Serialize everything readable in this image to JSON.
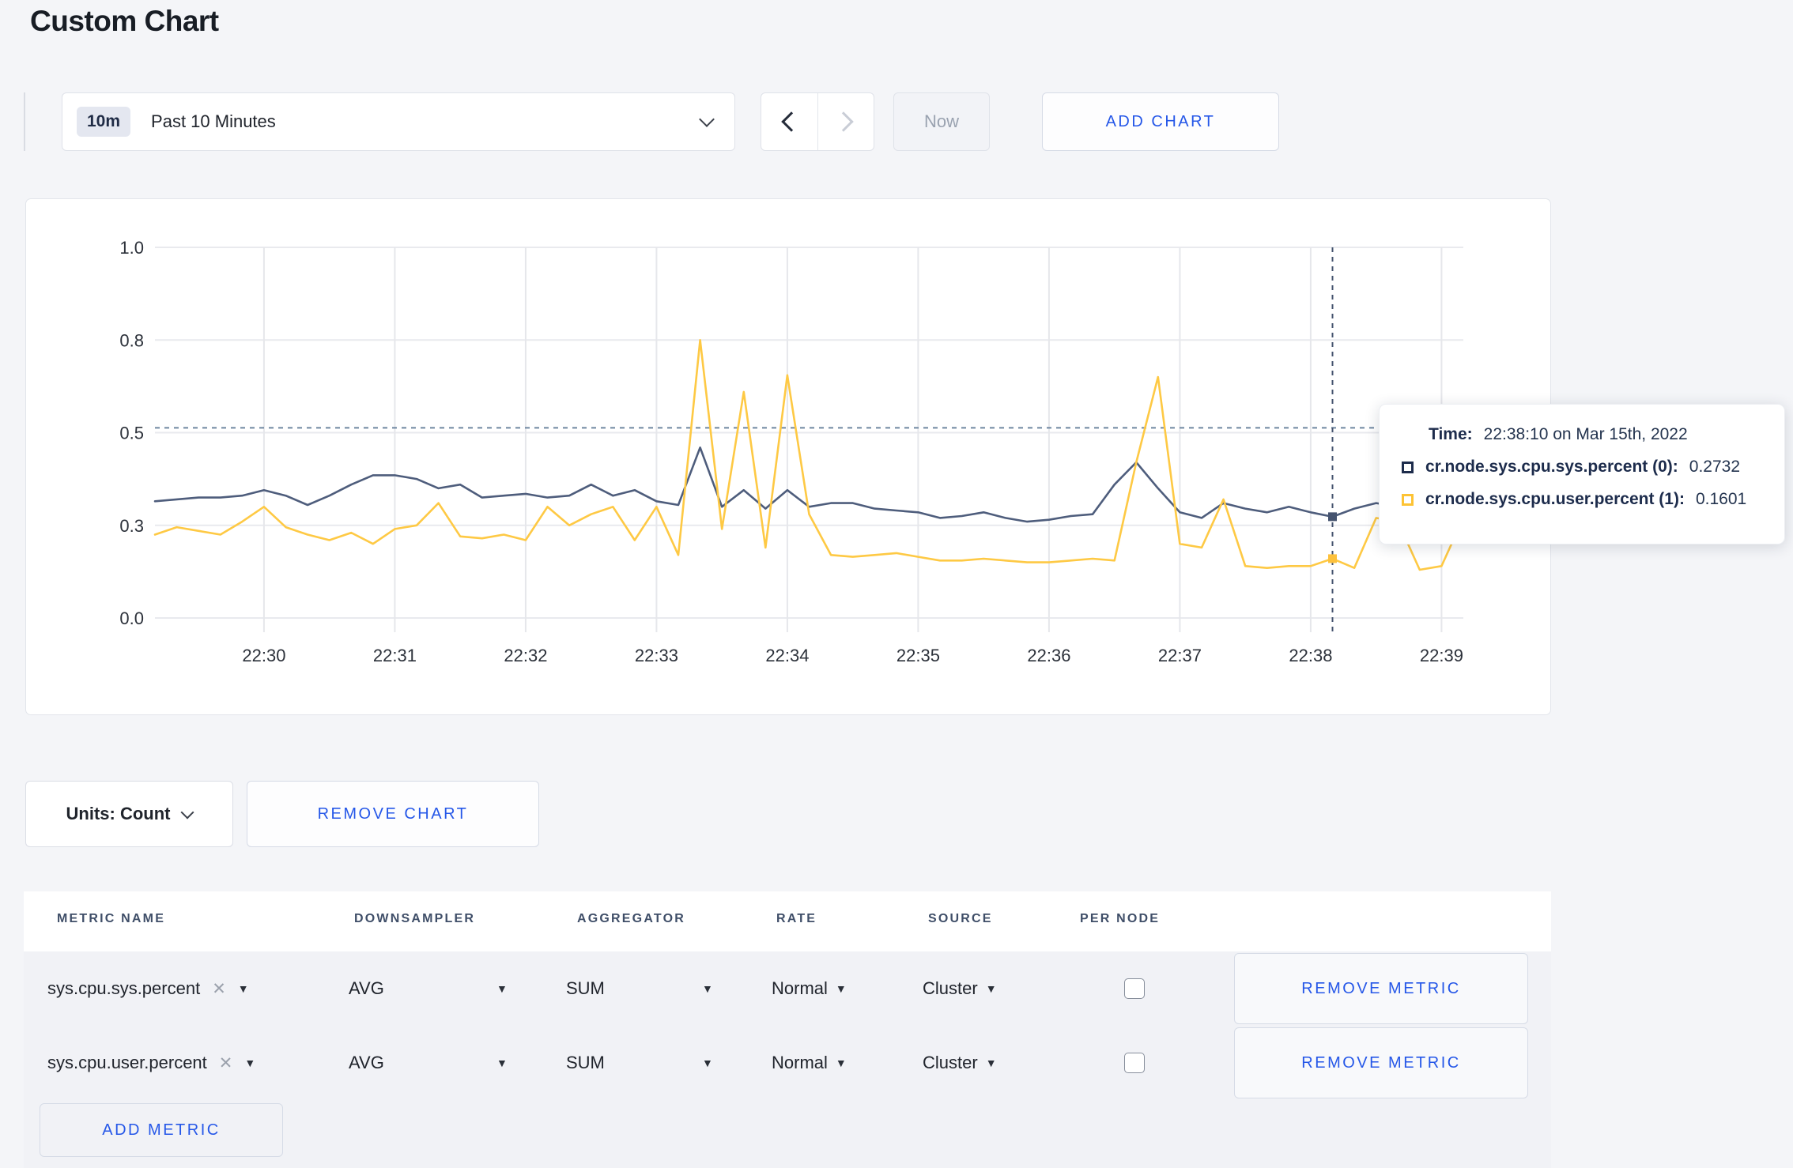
{
  "page": {
    "title": "Custom Chart"
  },
  "toolbar": {
    "range_badge": "10m",
    "range_label": "Past 10 Minutes",
    "now_label": "Now",
    "add_chart_label": "ADD CHART"
  },
  "chart": {
    "units_label": "Units: Count",
    "remove_chart_label": "REMOVE CHART"
  },
  "chart_data": {
    "type": "line",
    "title": "",
    "start_time": "22:29:10",
    "sample_interval_seconds": 10,
    "ylim": [
      0,
      1
    ],
    "grid": true,
    "legend_position": "tooltip",
    "y_ticks": [
      {
        "value": 0,
        "label": "0.0"
      },
      {
        "value": 0.25,
        "label": "0.3"
      },
      {
        "value": 0.5,
        "label": "0.5"
      },
      {
        "value": 0.75,
        "label": "0.8"
      },
      {
        "value": 1,
        "label": "1.0"
      }
    ],
    "x_ticks": [
      {
        "index": 5,
        "label": "22:30"
      },
      {
        "index": 11,
        "label": "22:31"
      },
      {
        "index": 17,
        "label": "22:32"
      },
      {
        "index": 23,
        "label": "22:33"
      },
      {
        "index": 29,
        "label": "22:34"
      },
      {
        "index": 35,
        "label": "22:35"
      },
      {
        "index": 41,
        "label": "22:36"
      },
      {
        "index": 47,
        "label": "22:37"
      },
      {
        "index": 53,
        "label": "22:38"
      },
      {
        "index": 59,
        "label": "22:39"
      }
    ],
    "series": [
      {
        "name": "cr.node.sys.cpu.sys.percent",
        "color": "#4e5d7c",
        "values": [
          0.315,
          0.32,
          0.325,
          0.325,
          0.33,
          0.345,
          0.33,
          0.305,
          0.33,
          0.36,
          0.385,
          0.385,
          0.375,
          0.35,
          0.36,
          0.325,
          0.33,
          0.335,
          0.325,
          0.33,
          0.36,
          0.33,
          0.345,
          0.315,
          0.305,
          0.46,
          0.3,
          0.345,
          0.295,
          0.345,
          0.3,
          0.31,
          0.31,
          0.295,
          0.29,
          0.285,
          0.27,
          0.275,
          0.285,
          0.27,
          0.26,
          0.265,
          0.275,
          0.28,
          0.36,
          0.42,
          0.35,
          0.285,
          0.27,
          0.31,
          0.295,
          0.285,
          0.3,
          0.285,
          0.2732,
          0.295,
          0.31,
          0.3,
          0.295,
          0.3,
          0.31
        ]
      },
      {
        "name": "cr.node.sys.cpu.user.percent",
        "color": "#fec944",
        "values": [
          0.225,
          0.245,
          0.235,
          0.225,
          0.26,
          0.3,
          0.245,
          0.225,
          0.21,
          0.23,
          0.2,
          0.24,
          0.25,
          0.31,
          0.22,
          0.215,
          0.225,
          0.21,
          0.3,
          0.25,
          0.28,
          0.3,
          0.21,
          0.3,
          0.17,
          0.75,
          0.24,
          0.61,
          0.19,
          0.655,
          0.28,
          0.17,
          0.165,
          0.17,
          0.175,
          0.165,
          0.155,
          0.155,
          0.16,
          0.155,
          0.15,
          0.15,
          0.155,
          0.16,
          0.155,
          0.42,
          0.65,
          0.2,
          0.19,
          0.32,
          0.14,
          0.135,
          0.14,
          0.14,
          0.1601,
          0.135,
          0.27,
          0.26,
          0.13,
          0.14,
          0.27
        ]
      }
    ],
    "crosshair": {
      "index": 54,
      "time": "22:38:10",
      "h_line_value": 0.513,
      "point_values": [
        0.2732,
        0.1601
      ]
    }
  },
  "tooltip": {
    "time_label": "Time:",
    "time_value": "22:38:10 on Mar 15th, 2022",
    "entries": [
      {
        "swatch_color": "#1d2c4c",
        "label": "cr.node.sys.cpu.sys.percent (0):",
        "value": "0.2732"
      },
      {
        "swatch_color": "#fdc334",
        "label": "cr.node.sys.cpu.user.percent (1):",
        "value": "0.1601"
      }
    ]
  },
  "metrics_table": {
    "headers": [
      "METRIC NAME",
      "DOWNSAMPLER",
      "AGGREGATOR",
      "RATE",
      "SOURCE",
      "PER NODE"
    ],
    "rows": [
      {
        "metric": "sys.cpu.sys.percent",
        "downsampler": "AVG",
        "aggregator": "SUM",
        "rate": "Normal",
        "source": "Cluster",
        "per_node_checked": false,
        "remove_label": "REMOVE METRIC"
      },
      {
        "metric": "sys.cpu.user.percent",
        "downsampler": "AVG",
        "aggregator": "SUM",
        "rate": "Normal",
        "source": "Cluster",
        "per_node_checked": false,
        "remove_label": "REMOVE METRIC"
      }
    ],
    "add_metric_label": "ADD METRIC"
  },
  "colors": {
    "accent_blue": "#2557e8",
    "page_background": "#f4f5f8",
    "series_sys_percent": "#4e5d7c",
    "series_user_percent": "#fec944",
    "crosshair": "#44536e"
  }
}
